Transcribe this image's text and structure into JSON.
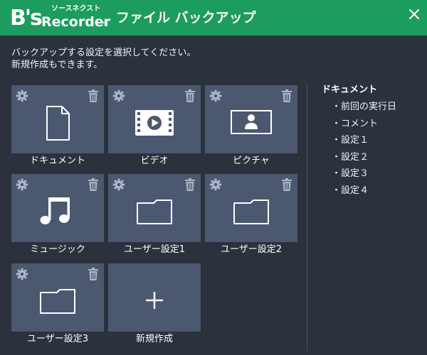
{
  "app": {
    "logo_small": "ソースネクスト",
    "logo_name": "Recorder",
    "logo_mark": "B's",
    "logo_reg": "®",
    "window_title": "ファイル バックアップ"
  },
  "instructions": {
    "line1": "バックアップする設定を選択してください。",
    "line2": "新規作成もできます。"
  },
  "tiles": [
    {
      "label": "ドキュメント",
      "icon": "document-icon"
    },
    {
      "label": "ビデオ",
      "icon": "video-icon"
    },
    {
      "label": "ピクチャ",
      "icon": "picture-icon"
    },
    {
      "label": "ミュージック",
      "icon": "music-icon"
    },
    {
      "label": "ユーザー設定1",
      "icon": "folder-icon"
    },
    {
      "label": "ユーザー設定2",
      "icon": "folder-icon"
    },
    {
      "label": "ユーザー設定3",
      "icon": "folder-icon"
    },
    {
      "label": "新規作成",
      "icon": "plus-icon"
    }
  ],
  "details": {
    "title": "ドキュメント",
    "items": [
      "・前回の実行日",
      "・コメント",
      "・設定１",
      "・設定２",
      "・設定３",
      "・設定４"
    ]
  },
  "colors": {
    "titlebar": "#1c9c5e",
    "background": "#2b323d",
    "tile": "#4c5870",
    "icon_muted": "#aeb8c6"
  }
}
